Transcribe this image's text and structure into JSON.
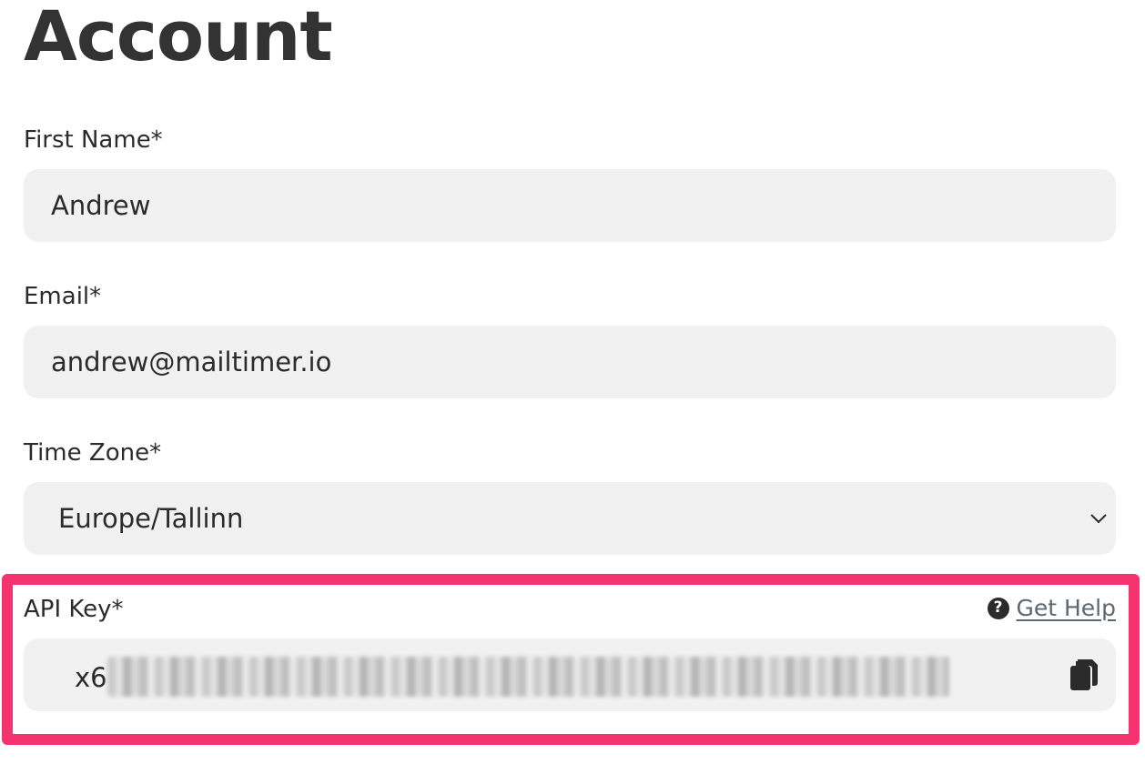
{
  "page": {
    "title": "Account"
  },
  "form": {
    "first_name": {
      "label": "First Name*",
      "value": "Andrew"
    },
    "email": {
      "label": "Email*",
      "value": "andrew@mailtimer.io"
    },
    "time_zone": {
      "label": "Time Zone*",
      "selected": "Europe/Tallinn"
    },
    "api_key": {
      "label": "API Key*",
      "visible_prefix": "x6",
      "help_link_label": "Get Help"
    }
  },
  "icons": {
    "help": "question-circle-icon",
    "help_glyph": "?",
    "copy": "copy-icon",
    "dropdown": "chevron-down-icon"
  },
  "colors": {
    "highlight": "#f4336f",
    "field_background": "#f1f1f1",
    "link": "#5d6770"
  }
}
